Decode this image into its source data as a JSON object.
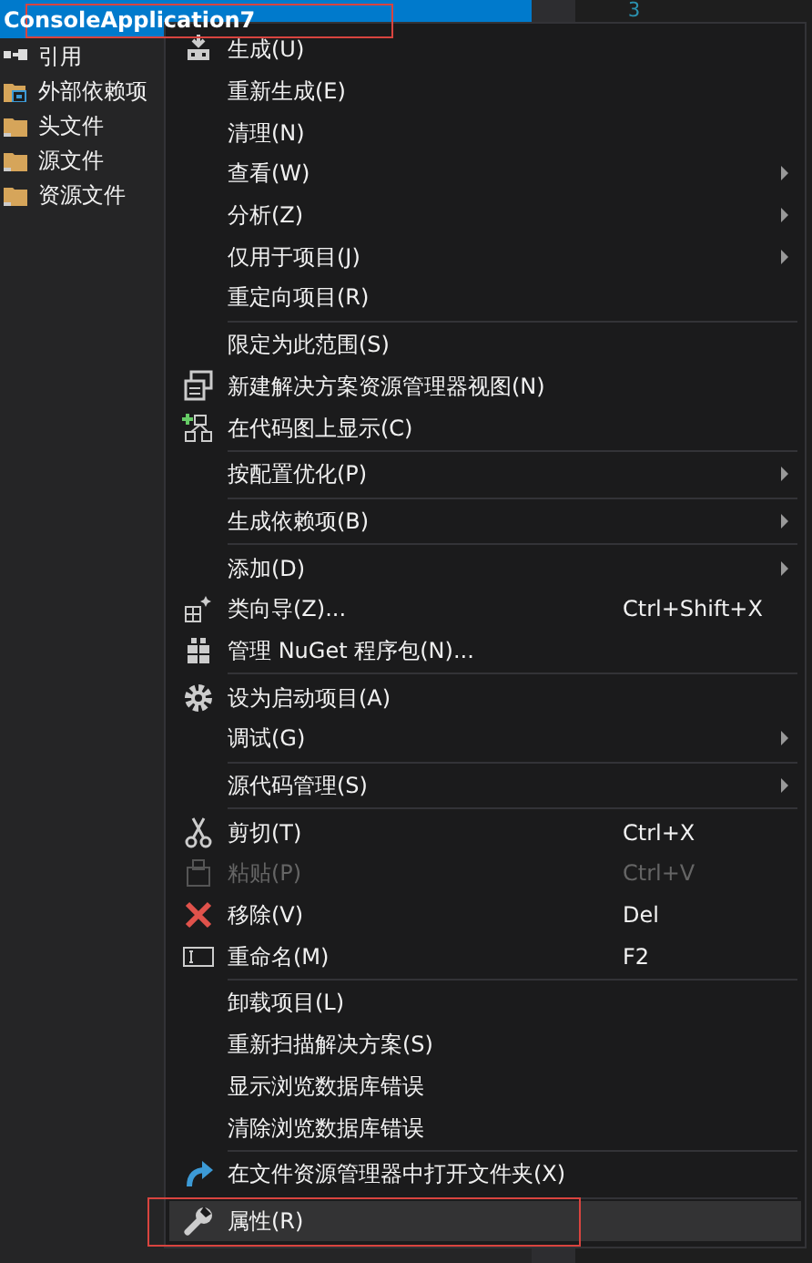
{
  "project": {
    "title": "ConsoleApplication7",
    "selected": true,
    "annotated": true
  },
  "tree": [
    {
      "label": "引用"
    },
    {
      "label": "外部依赖项"
    },
    {
      "label": "头文件"
    },
    {
      "label": "源文件"
    },
    {
      "label": "资源文件"
    }
  ],
  "editor": {
    "line_number": "3"
  },
  "context_menu": [
    {
      "kind": "item",
      "label": "生成(U)",
      "submenu": false,
      "disabled": false,
      "selected": false
    },
    {
      "kind": "item",
      "label": "重新生成(E)",
      "submenu": false,
      "disabled": false,
      "selected": false
    },
    {
      "kind": "item",
      "label": "清理(N)",
      "submenu": false,
      "disabled": false,
      "selected": false
    },
    {
      "kind": "item",
      "label": "查看(W)",
      "submenu": true,
      "disabled": false,
      "selected": false
    },
    {
      "kind": "item",
      "label": "分析(Z)",
      "submenu": true,
      "disabled": false,
      "selected": false
    },
    {
      "kind": "item",
      "label": "仅用于项目(J)",
      "submenu": true,
      "disabled": false,
      "selected": false
    },
    {
      "kind": "item",
      "label": "重定向项目(R)",
      "submenu": false,
      "disabled": false,
      "selected": false
    },
    {
      "kind": "separator"
    },
    {
      "kind": "item",
      "label": "限定为此范围(S)",
      "submenu": false,
      "disabled": false,
      "selected": false
    },
    {
      "kind": "item",
      "label": "新建解决方案资源管理器视图(N)",
      "submenu": false,
      "disabled": false,
      "selected": false
    },
    {
      "kind": "item",
      "label": "在代码图上显示(C)",
      "submenu": false,
      "disabled": false,
      "selected": false
    },
    {
      "kind": "separator"
    },
    {
      "kind": "item",
      "label": "按配置优化(P)",
      "submenu": true,
      "disabled": false,
      "selected": false
    },
    {
      "kind": "separator"
    },
    {
      "kind": "item",
      "label": "生成依赖项(B)",
      "submenu": true,
      "disabled": false,
      "selected": false
    },
    {
      "kind": "separator"
    },
    {
      "kind": "item",
      "label": "添加(D)",
      "submenu": true,
      "disabled": false,
      "selected": false
    },
    {
      "kind": "item",
      "label": "类向导(Z)...",
      "shortcut": "Ctrl+Shift+X",
      "submenu": false,
      "disabled": false,
      "selected": false
    },
    {
      "kind": "item",
      "label": "管理 NuGet 程序包(N)...",
      "submenu": false,
      "disabled": false,
      "selected": false
    },
    {
      "kind": "separator"
    },
    {
      "kind": "item",
      "label": "设为启动项目(A)",
      "submenu": false,
      "disabled": false,
      "selected": false
    },
    {
      "kind": "item",
      "label": "调试(G)",
      "submenu": true,
      "disabled": false,
      "selected": false
    },
    {
      "kind": "separator"
    },
    {
      "kind": "item",
      "label": "源代码管理(S)",
      "submenu": true,
      "disabled": false,
      "selected": false
    },
    {
      "kind": "separator"
    },
    {
      "kind": "item",
      "label": "剪切(T)",
      "shortcut": "Ctrl+X",
      "submenu": false,
      "disabled": false,
      "selected": false
    },
    {
      "kind": "item",
      "label": "粘贴(P)",
      "shortcut": "Ctrl+V",
      "submenu": false,
      "disabled": true,
      "selected": false
    },
    {
      "kind": "item",
      "label": "移除(V)",
      "shortcut": "Del",
      "submenu": false,
      "disabled": false,
      "selected": false
    },
    {
      "kind": "item",
      "label": "重命名(M)",
      "shortcut": "F2",
      "submenu": false,
      "disabled": false,
      "selected": false
    },
    {
      "kind": "separator"
    },
    {
      "kind": "item",
      "label": "卸载项目(L)",
      "submenu": false,
      "disabled": false,
      "selected": false
    },
    {
      "kind": "item",
      "label": "重新扫描解决方案(S)",
      "submenu": false,
      "disabled": false,
      "selected": false
    },
    {
      "kind": "item",
      "label": "显示浏览数据库错误",
      "submenu": false,
      "disabled": false,
      "selected": false
    },
    {
      "kind": "item",
      "label": "清除浏览数据库错误",
      "submenu": false,
      "disabled": false,
      "selected": false
    },
    {
      "kind": "separator"
    },
    {
      "kind": "item",
      "label": "在文件资源管理器中打开文件夹(X)",
      "submenu": false,
      "disabled": false,
      "selected": false
    },
    {
      "kind": "separator"
    },
    {
      "kind": "item",
      "label": "属性(R)",
      "submenu": false,
      "disabled": false,
      "selected": true,
      "annotated": true
    }
  ]
}
